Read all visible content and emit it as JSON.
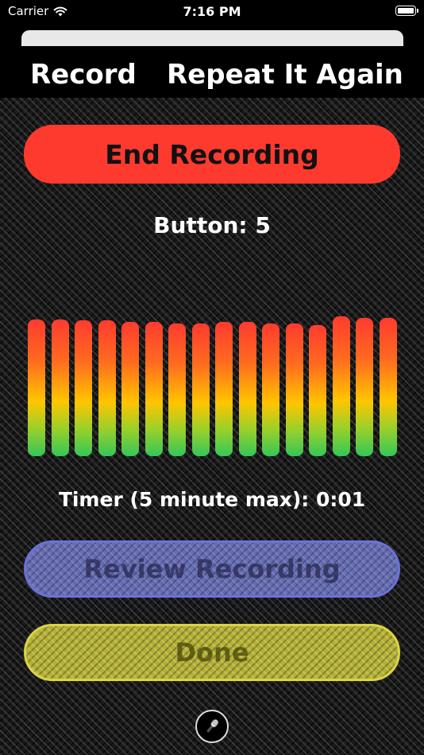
{
  "status_bar": {
    "carrier": "Carrier",
    "time": "7:16 PM"
  },
  "header": {
    "left_title": "Record",
    "right_title": "Repeat It Again"
  },
  "main": {
    "end_recording_label": "End Recording",
    "button_label": "Button: 5",
    "timer_label": "Timer (5 minute max): 0:01",
    "review_recording_label": "Review Recording",
    "done_label": "Done"
  },
  "meter": {
    "levels": [
      0.88,
      0.88,
      0.87,
      0.87,
      0.86,
      0.86,
      0.85,
      0.85,
      0.86,
      0.86,
      0.85,
      0.85,
      0.84,
      0.9,
      0.89,
      0.89
    ]
  },
  "colors": {
    "end_button": "#fe3a2f",
    "review_button": "#7882dc",
    "done_button": "#d7d23c",
    "meter_top": "#ff3b30",
    "meter_mid": "#ffc500",
    "meter_bottom": "#34c759"
  },
  "icons": {
    "wifi": "wifi-icon",
    "battery": "battery-icon",
    "microphone": "microphone-icon"
  }
}
